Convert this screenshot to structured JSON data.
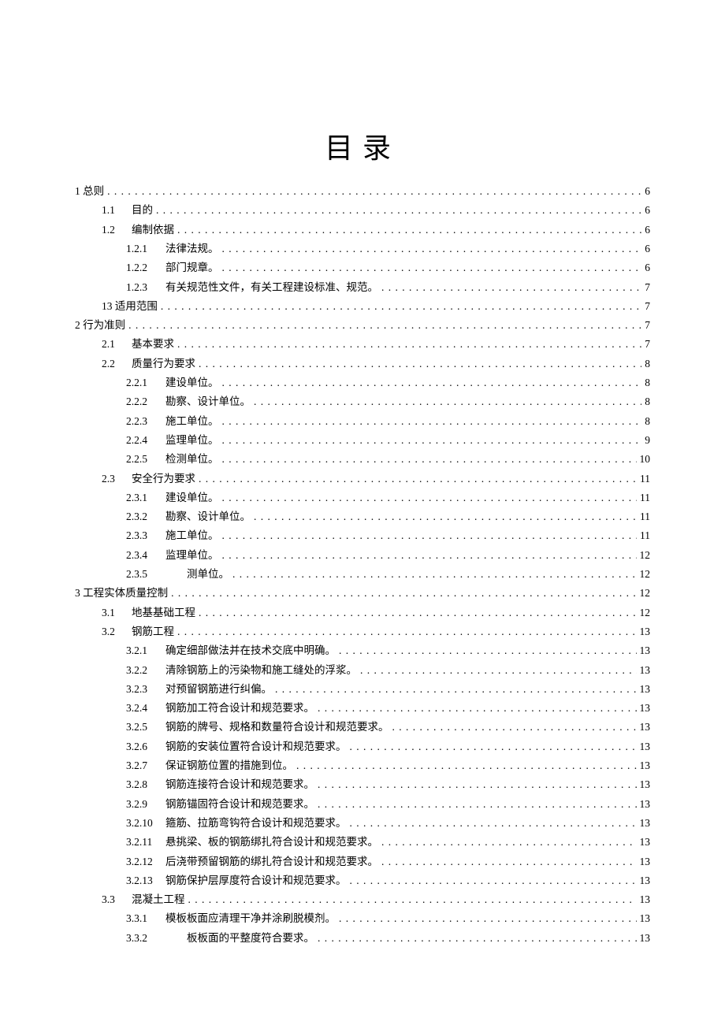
{
  "title": "目录",
  "toc": [
    {
      "level": 1,
      "num": "1",
      "text": "总则",
      "page": "6",
      "joined": true
    },
    {
      "level": 2,
      "num": "1.1",
      "text": "目的",
      "page": "6"
    },
    {
      "level": 2,
      "num": "1.2",
      "text": "编制依据",
      "page": "6"
    },
    {
      "level": 3,
      "num": "1.2.1",
      "text": "法律法规。",
      "page": "6"
    },
    {
      "level": 3,
      "num": "1.2.2",
      "text": "部门规章。",
      "page": "6"
    },
    {
      "level": 3,
      "num": "1.2.3",
      "text": "有关规范性文件，有关工程建设标准、规范。",
      "page": "7"
    },
    {
      "level": 2,
      "num": "13",
      "text": "适用范围",
      "page": "7",
      "joined": true
    },
    {
      "level": 1,
      "num": "2",
      "text": "行为准则",
      "page": "7",
      "joined": true
    },
    {
      "level": 2,
      "num": "2.1",
      "text": "基本要求",
      "page": "7"
    },
    {
      "level": 2,
      "num": "2.2",
      "text": "质量行为要求",
      "page": "8"
    },
    {
      "level": 3,
      "num": "2.2.1",
      "text": "建设单位。",
      "page": "8"
    },
    {
      "level": 3,
      "num": "2.2.2",
      "text": "勘察、设计单位。",
      "page": "8"
    },
    {
      "level": 3,
      "num": "2.2.3",
      "text": "施工单位。",
      "page": "8"
    },
    {
      "level": 3,
      "num": "2.2.4",
      "text": "监理单位。",
      "page": "9"
    },
    {
      "level": 3,
      "num": "2.2.5",
      "text": "检测单位。",
      "page": "10"
    },
    {
      "level": 2,
      "num": "2.3",
      "text": "安全行为要求",
      "page": "11"
    },
    {
      "level": 3,
      "num": "2.3.1",
      "text": "建设单位。",
      "page": "11"
    },
    {
      "level": 3,
      "num": "2.3.2",
      "text": "勘察、设计单位。",
      "page": "11"
    },
    {
      "level": 3,
      "num": "2.3.3",
      "text": "施工单位。",
      "page": "11"
    },
    {
      "level": 3,
      "num": "2.3.4",
      "text": "监理单位。",
      "page": "12"
    },
    {
      "level": 3,
      "num": "2.3.5",
      "text": "　　测单位。",
      "page": "12"
    },
    {
      "level": 1,
      "num": "3",
      "text": "工程实体质量控制",
      "page": "12",
      "joined": true
    },
    {
      "level": 2,
      "num": "3.1",
      "text": "地基基础工程",
      "page": "12"
    },
    {
      "level": 2,
      "num": "3.2",
      "text": "钢筋工程",
      "page": "13"
    },
    {
      "level": 3,
      "num": "3.2.1",
      "text": "确定细部做法并在技术交底中明确。",
      "page": "13"
    },
    {
      "level": 3,
      "num": "3.2.2",
      "text": "清除钢筋上的污染物和施工缝处的浮浆。",
      "page": "13"
    },
    {
      "level": 3,
      "num": "3.2.3",
      "text": "对预留钢筋进行纠偏。",
      "page": "13"
    },
    {
      "level": 3,
      "num": "3.2.4",
      "text": "钢筋加工符合设计和规范要求。",
      "page": "13"
    },
    {
      "level": 3,
      "num": "3.2.5",
      "text": "钢筋的牌号、规格和数量符合设计和规范要求。",
      "page": "13"
    },
    {
      "level": 3,
      "num": "3.2.6",
      "text": "钢筋的安装位置符合设计和规范要求。",
      "page": "13"
    },
    {
      "level": 3,
      "num": "3.2.7",
      "text": "保证钢筋位置的措施到位。",
      "page": "13"
    },
    {
      "level": 3,
      "num": "3.2.8",
      "text": "钢筋连接符合设计和规范要求。",
      "page": "13"
    },
    {
      "level": 3,
      "num": "3.2.9",
      "text": "钢筋锚固符合设计和规范要求。",
      "page": "13"
    },
    {
      "level": 3,
      "num": "3.2.10",
      "text": "箍筋、拉筋弯钩符合设计和规范要求。",
      "page": "13"
    },
    {
      "level": 3,
      "num": "3.2.11",
      "text": "悬挑梁、板的钢筋绑扎符合设计和规范要求。",
      "page": "13"
    },
    {
      "level": 3,
      "num": "3.2.12",
      "text": "后浇带预留钢筋的绑扎符合设计和规范要求。",
      "page": "13"
    },
    {
      "level": 3,
      "num": "3.2.13",
      "text": "钢筋保护层厚度符合设计和规范要求。",
      "page": "13"
    },
    {
      "level": 2,
      "num": "3.3",
      "text": "混凝土工程",
      "page": "13"
    },
    {
      "level": 3,
      "num": "3.3.1",
      "text": "模板板面应清理干净并涂刷脱模剂。",
      "page": "13"
    },
    {
      "level": 3,
      "num": "3.3.2",
      "text": "　　板板面的平整度符合要求。",
      "page": "13"
    }
  ]
}
